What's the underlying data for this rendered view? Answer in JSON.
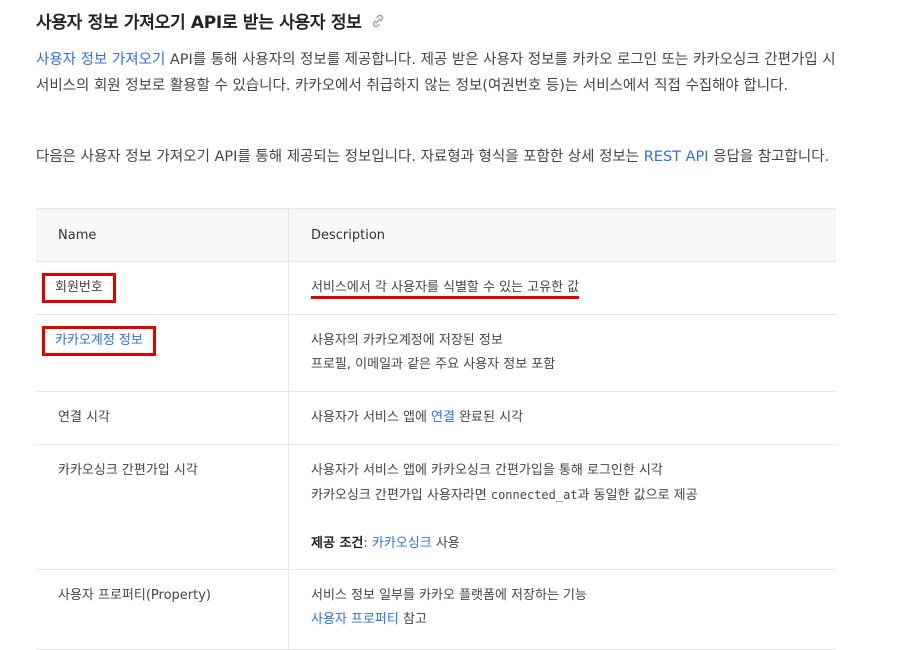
{
  "heading": {
    "title": "사용자 정보 가져오기 API로 받는 사용자 정보",
    "anchor_icon": "link-icon"
  },
  "intro": {
    "link_text": "사용자 정보 가져오기",
    "text_1": " API를 통해 사용자의 정보를 제공합니다. 제공 받은 사용자 정보를 카카오 로그인 또는 카카오싱크 간편가입 시 서비스의 회원 정보로 활용할 수 있습니다. 카카오에서 취급하지 않는 정보(여권번호 등)는 서비스에서 직접 수집해야 합니다."
  },
  "para2": {
    "text_1": "다음은 사용자 정보 가져오기 API를 통해 제공되는 정보입니다. 자료형과 형식을 포함한 상세 정보는 ",
    "link_text": "REST API",
    "text_2": " 응답을 참고합니다."
  },
  "table": {
    "headers": {
      "name": "Name",
      "description": "Description"
    },
    "rows": [
      {
        "name": "회원번호",
        "desc": "서비스에서 각 사용자를 식별할 수 있는 고유한 값"
      },
      {
        "name": "카카오계정 정보",
        "desc_1": "사용자의 카카오계정에 저장된 정보",
        "desc_2": "프로필, 이메일과 같은 주요 사용자 정보 포함"
      },
      {
        "name": "연결 시각",
        "desc_pre": "사용자가 서비스 앱에 ",
        "desc_link": "연결",
        "desc_post": " 완료된 시각"
      },
      {
        "name": "카카오싱크 간편가입 시각",
        "desc_1": "사용자가 서비스 앱에 카카오싱크 간편가입을 통해 로그인한 시각",
        "desc_2_pre": "카카오싱크 간편가입 사용자라면 ",
        "desc_2_code": "connected_at",
        "desc_2_post": "과 동일한 값으로 제공",
        "cond_label": "제공 조건",
        "cond_sep": ": ",
        "cond_link": "카카오싱크",
        "cond_post": " 사용"
      },
      {
        "name": "사용자 프로퍼티(Property)",
        "desc_1": "서비스 정보 일부를 카카오 플랫폼에 저장하는 기능",
        "desc_link": "사용자 프로퍼티",
        "desc_post": " 참고"
      }
    ]
  },
  "colors": {
    "link": "#2f6fd6",
    "highlight": "#e00000"
  }
}
